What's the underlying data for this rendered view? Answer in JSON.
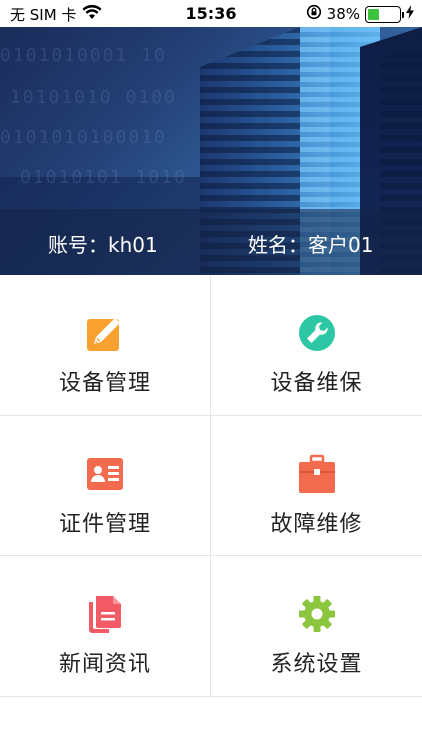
{
  "status_bar": {
    "carrier": "无 SIM 卡",
    "time": "15:36",
    "battery_percent": "38%",
    "battery_level": 0.38
  },
  "banner": {
    "account_label": "账号：kh01",
    "name_label": "姓名：客户01"
  },
  "menu": {
    "items": [
      {
        "label": "设备管理",
        "icon": "edit-icon",
        "color": "#F8A030"
      },
      {
        "label": "设备维保",
        "icon": "wrench-icon",
        "color": "#2EC7A5"
      },
      {
        "label": "证件管理",
        "icon": "id-card-icon",
        "color": "#F26B4F"
      },
      {
        "label": "故障维修",
        "icon": "briefcase-icon",
        "color": "#F26B4F"
      },
      {
        "label": "新闻资讯",
        "icon": "document-icon",
        "color": "#F25A66"
      },
      {
        "label": "系统设置",
        "icon": "gear-icon",
        "color": "#8CC63F"
      }
    ]
  }
}
